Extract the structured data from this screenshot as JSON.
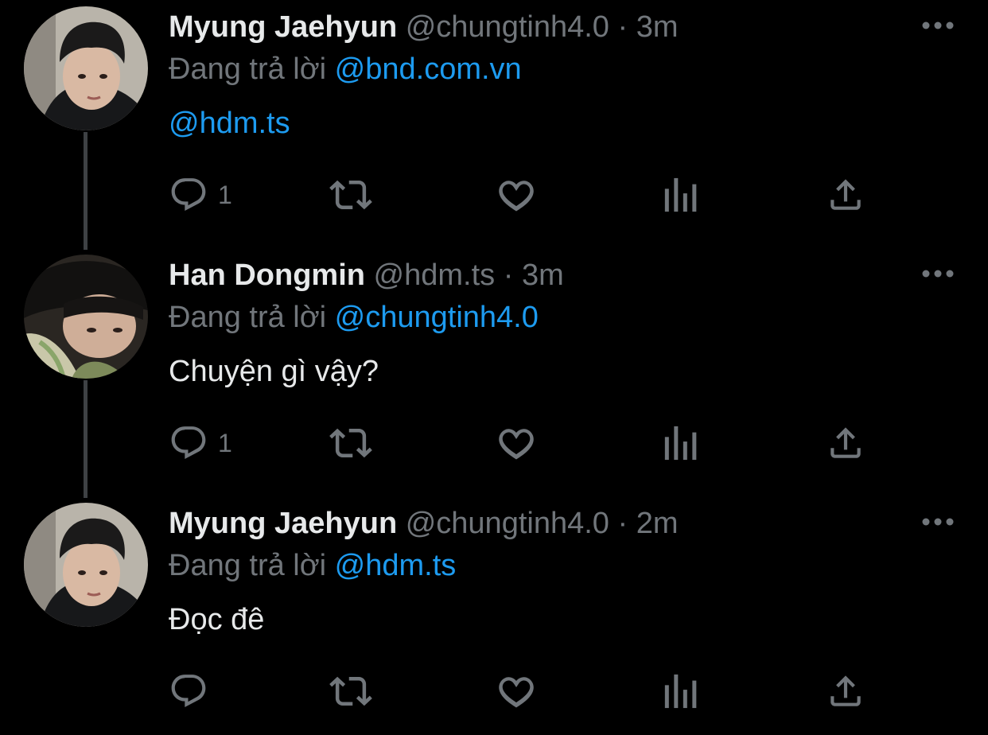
{
  "theme": {
    "background": "#000000",
    "text_primary": "#e7e9ea",
    "text_secondary": "#71767b",
    "link": "#1d9bf0",
    "thread_line": "#3e4144"
  },
  "reply_prefix": "Đang trả lời",
  "tweets": [
    {
      "author_name": "Myung Jaehyun",
      "handle": "@chungtinh4.0",
      "separator": "·",
      "time": "3m",
      "reply_to": "@bnd.com.vn",
      "text": "@hdm.ts",
      "text_is_mention": true,
      "reply_count": "1",
      "avatar_icon": "user-avatar-photo",
      "icons": [
        "more-icon",
        "reply-icon",
        "retweet-icon",
        "like-icon",
        "analytics-icon",
        "share-icon"
      ]
    },
    {
      "author_name": "Han Dongmin",
      "handle": "@hdm.ts",
      "separator": "·",
      "time": "3m",
      "reply_to": "@chungtinh4.0",
      "text": "Chuyện gì vậy?",
      "text_is_mention": false,
      "reply_count": "1",
      "avatar_icon": "user-avatar-photo",
      "icons": [
        "more-icon",
        "reply-icon",
        "retweet-icon",
        "like-icon",
        "analytics-icon",
        "share-icon"
      ]
    },
    {
      "author_name": "Myung Jaehyun",
      "handle": "@chungtinh4.0",
      "separator": "·",
      "time": "2m",
      "reply_to": "@hdm.ts",
      "text": "Đọc đê",
      "text_is_mention": false,
      "reply_count": "",
      "avatar_icon": "user-avatar-photo",
      "icons": [
        "more-icon",
        "reply-icon",
        "retweet-icon",
        "like-icon",
        "analytics-icon",
        "share-icon"
      ]
    }
  ]
}
